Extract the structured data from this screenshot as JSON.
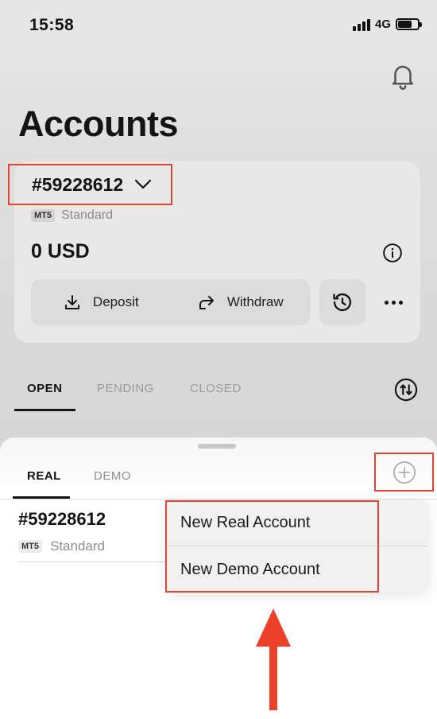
{
  "status_bar": {
    "time": "15:58",
    "network": "4G"
  },
  "header": {
    "title": "Accounts"
  },
  "account": {
    "number": "#59228612",
    "platform": "MT5",
    "type": "Standard",
    "balance": "0 USD"
  },
  "actions": {
    "deposit": "Deposit",
    "withdraw": "Withdraw"
  },
  "order_tabs": [
    "OPEN",
    "PENDING",
    "CLOSED"
  ],
  "sheet": {
    "tabs": [
      "REAL",
      "DEMO"
    ],
    "accounts": [
      {
        "number": "#59228612",
        "platform": "MT5",
        "type": "Standard"
      }
    ],
    "menu": [
      "New Real Account",
      "New Demo Account"
    ]
  },
  "colors": {
    "highlight": "#e2452f",
    "text": "#141414",
    "muted": "#9a9a9a"
  }
}
